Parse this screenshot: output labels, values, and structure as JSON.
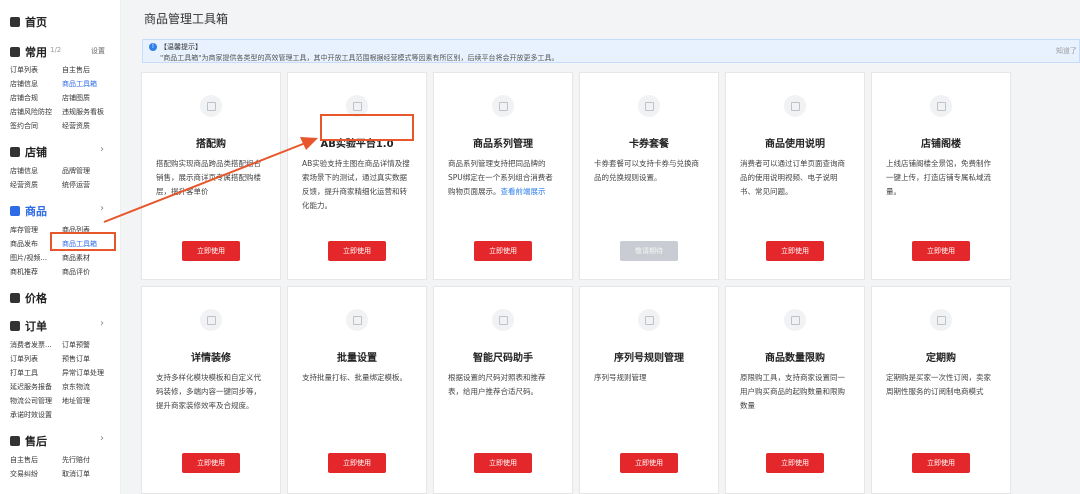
{
  "sidebar": {
    "home": "首页",
    "common": {
      "title": "常用",
      "page": "1/2",
      "settings": "设置",
      "items": [
        "订单列表",
        "自主售后",
        "店铺信息",
        "商品工具箱",
        "店铺合规",
        "店铺图质",
        "店铺风险防控",
        "违规服务看板",
        "签约合同",
        "经营资质"
      ]
    },
    "shop": {
      "title": "店铺",
      "items": [
        "店铺信息",
        "品牌管理",
        "经营资质",
        "统停运营"
      ]
    },
    "goods": {
      "title": "商品",
      "items": [
        "库存管理",
        "商品列表",
        "商品发布",
        "商品工具箱",
        "图片/视频...",
        "商品素材",
        "商机推荐",
        "商品评价"
      ]
    },
    "price": {
      "title": "价格"
    },
    "order": {
      "title": "订单",
      "items": [
        "消费者发票...",
        "订单预警",
        "订单列表",
        "预售订单",
        "打单工具",
        "异常订单处理",
        "延迟服务报备",
        "京东物流",
        "物流公司管理",
        "地址管理",
        "承诺时效设置"
      ]
    },
    "after": {
      "title": "售后",
      "items": [
        "自主售后",
        "先行赔付",
        "交易纠纷",
        "取消订单"
      ]
    }
  },
  "main": {
    "title": "商品管理工具箱",
    "notice": {
      "title": "【温馨提示】",
      "body": "\"商品工具箱\"为商家提供各类型的高效管理工具，其中开放工具范围根据经营模式等因素有所区别，后续平台将会开放更多工具。",
      "right": "知道了"
    },
    "cards": [
      {
        "title": "搭配购",
        "desc": "搭配购实现商品跨品类搭配组合销售，展示商详页专属搭配购楼层，提升客单价",
        "button": "立即使用",
        "disabled": false,
        "icon": "bundle-icon"
      },
      {
        "title": "AB实验平台1.0",
        "desc": "AB实验支持主图在商品详情及搜索场景下的测试，通过真实数据反馈，提升商家精细化运营和转化能力。",
        "button": "立即使用",
        "disabled": false,
        "icon": "ab-test-icon"
      },
      {
        "title": "商品系列管理",
        "desc": "商品系列管理支持把同品牌的SPU绑定在一个系列组合消费者购物页面展示。",
        "link": "查看前端展示",
        "button": "立即使用",
        "disabled": false,
        "icon": "tag-icon"
      },
      {
        "title": "卡券套餐",
        "desc": "卡券套餐可以支持卡券与兑换商品的兑换规则设置。",
        "button": "敬请期待",
        "disabled": true,
        "icon": "coupon-icon"
      },
      {
        "title": "商品使用说明",
        "desc": "消费者可以通过订单页面查询商品的使用说明视频、电子说明书、常见问题。",
        "button": "立即使用",
        "disabled": false,
        "icon": "manual-icon"
      },
      {
        "title": "店铺阁楼",
        "desc": "上线店铺阁楼全景馆，免费制作 一键上传，打造店铺专属私域流量。",
        "button": "立即使用",
        "disabled": false,
        "icon": "store-icon"
      },
      {
        "title": "详情装修",
        "desc": "支持多样化模块模板和自定义代码装修，多端内容一键同步等，提升商家装修效率及合规度。",
        "button": "立即使用",
        "disabled": false,
        "icon": "decorate-icon"
      },
      {
        "title": "批量设置",
        "desc": "支持批量打标、批量绑定模板。",
        "button": "立即使用",
        "disabled": false,
        "icon": "label-icon"
      },
      {
        "title": "智能尺码助手",
        "desc": "根据设置的尺码对照表和推荐表，给用户推荐合适尺码。",
        "button": "立即使用",
        "disabled": false,
        "icon": "size-icon"
      },
      {
        "title": "序列号规则管理",
        "desc": "序列号规则管理",
        "button": "立即使用",
        "disabled": false,
        "icon": "serial-icon"
      },
      {
        "title": "商品数量限购",
        "desc": "原限购工具，支持商家设置同一用户购买商品的起购数量和限购数量",
        "button": "立即使用",
        "disabled": false,
        "icon": "limit-icon"
      },
      {
        "title": "定期购",
        "desc": "定期购是买家一次性订阅，卖家周期性服务的订阅制电商模式",
        "button": "立即使用",
        "disabled": false,
        "icon": "subscribe-icon"
      }
    ]
  }
}
